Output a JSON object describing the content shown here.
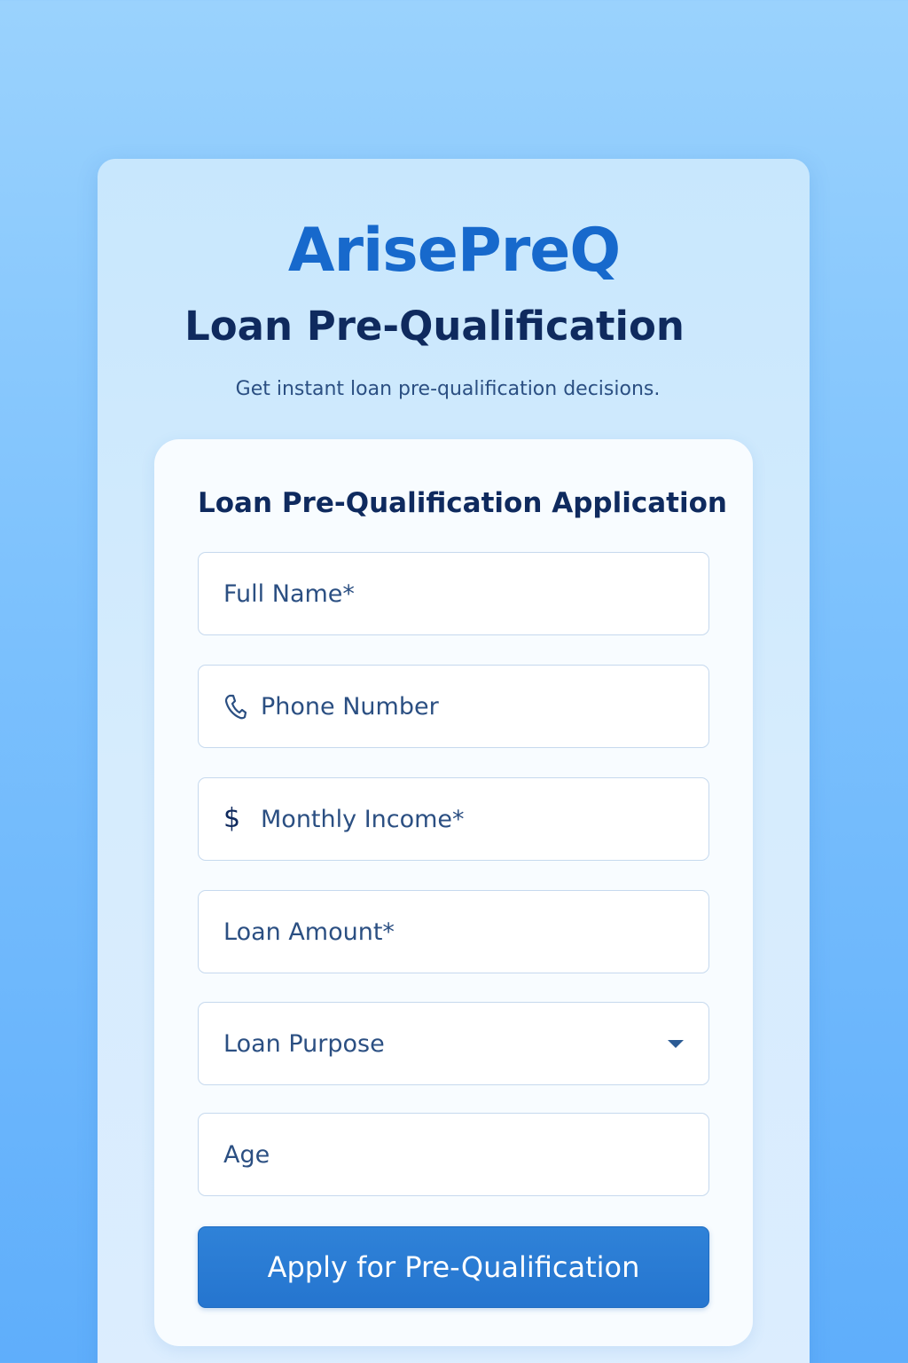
{
  "app": {
    "brand": "ArisePreQ",
    "title": "Loan Pre-Qualification",
    "subtitle": "Get instant loan pre-qualification decisions."
  },
  "form": {
    "heading": "Loan Pre-Qualification Application",
    "fields": {
      "full_name": {
        "placeholder": "Full Name*",
        "value": ""
      },
      "phone": {
        "placeholder": "Phone Number",
        "value": "",
        "icon": "phone-icon"
      },
      "monthly_income": {
        "placeholder": "Monthly Income*",
        "value": "",
        "icon": "dollar-icon",
        "icon_glyph": "$"
      },
      "loan_amount": {
        "placeholder": "Loan Amount*",
        "value": ""
      },
      "loan_purpose": {
        "selected": "Loan Purpose",
        "icon": "chevron-down-icon"
      },
      "age": {
        "placeholder": "Age",
        "value": ""
      }
    },
    "submit_label": "Apply for Pre-Qualification"
  },
  "colors": {
    "accent": "#2575cf",
    "brand": "#1769cc",
    "heading": "#0f2a5e",
    "text": "#2b4f82"
  }
}
